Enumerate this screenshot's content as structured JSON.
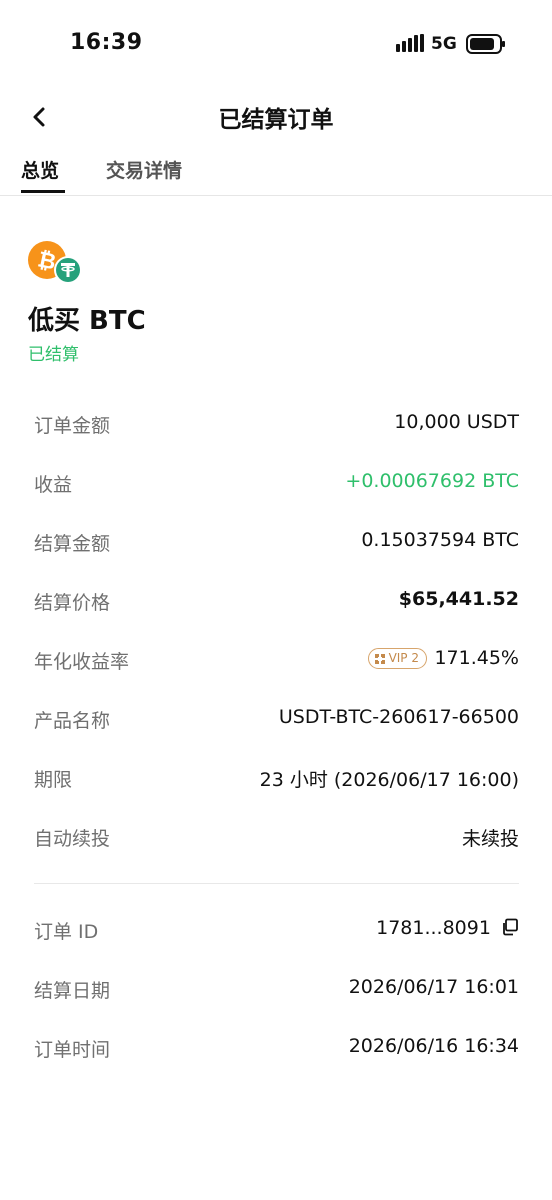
{
  "status_bar": {
    "time": "16:39",
    "network": "5G"
  },
  "header": {
    "title": "已结算订单"
  },
  "tabs": [
    {
      "label": "总览"
    },
    {
      "label": "交易详情"
    }
  ],
  "product": {
    "title": "低买 BTC",
    "status": "已结算"
  },
  "details": [
    {
      "label": "订单金额",
      "value": "10,000 USDT"
    },
    {
      "label": "收益",
      "value": "+0.00067692 BTC"
    },
    {
      "label": "结算金额",
      "value": "0.15037594 BTC"
    },
    {
      "label": "结算价格",
      "value": "$65,441.52"
    },
    {
      "label": "年化收益率",
      "value": "171.45%",
      "badge": "VIP 2"
    },
    {
      "label": "产品名称",
      "value": "USDT-BTC-260617-66500"
    },
    {
      "label": "期限",
      "value": "23 小时 (2026/06/17 16:00)"
    },
    {
      "label": "自动续投",
      "value": "未续投"
    }
  ],
  "order_info": [
    {
      "label": "订单 ID",
      "value": "1781...8091"
    },
    {
      "label": "结算日期",
      "value": "2026/06/17 16:01"
    },
    {
      "label": "订单时间",
      "value": "2026/06/16 16:34"
    }
  ],
  "colors": {
    "positive": "#2fbf6b",
    "btc": "#f7931a",
    "usdt": "#26a17b",
    "vip": "#c48a4c"
  }
}
